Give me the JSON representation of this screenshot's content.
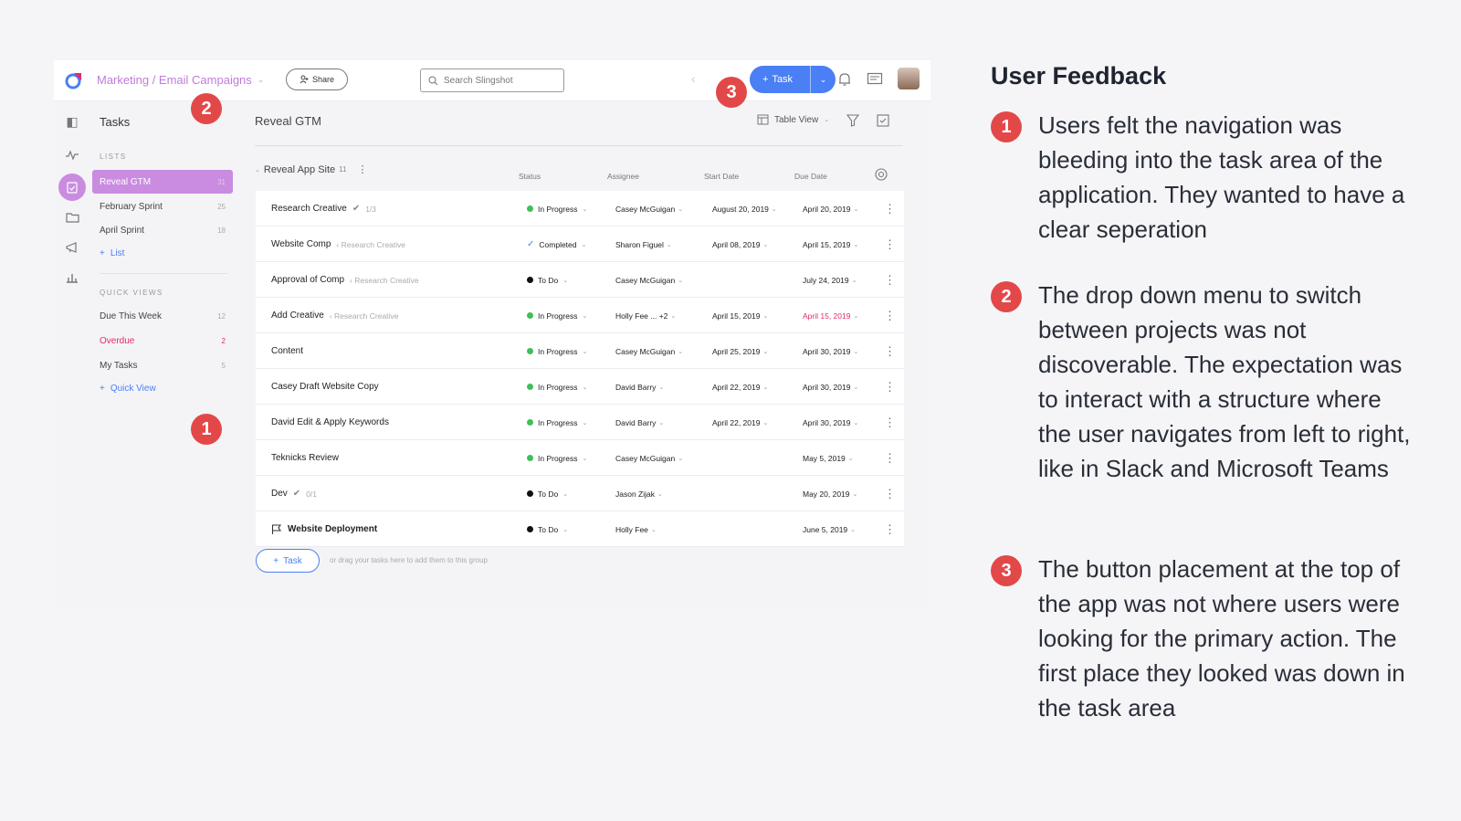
{
  "app": {
    "breadcrumb": "Marketing / Email Campaigns",
    "share_label": "Share",
    "search_placeholder": "Search Slingshot",
    "task_button_label": "Task",
    "accent_color": "#4a7ff5",
    "nav_accent_color": "#c98ce0"
  },
  "sidebar": {
    "title": "Tasks",
    "lists_header": "LISTS",
    "lists": [
      {
        "label": "Reveal GTM",
        "count": "31"
      },
      {
        "label": "February Sprint",
        "count": "25"
      },
      {
        "label": "April Sprint",
        "count": "18"
      }
    ],
    "add_list_label": "List",
    "quick_views_header": "QUICK VIEWS",
    "quick_views": [
      {
        "label": "Due This Week",
        "count": "12"
      },
      {
        "label": "Overdue",
        "count": "2"
      },
      {
        "label": "My Tasks",
        "count": "5"
      }
    ],
    "add_quick_view_label": "Quick View"
  },
  "main": {
    "title": "Reveal GTM",
    "view_label": "Table View",
    "group_name": "Reveal App Site",
    "group_count": "11",
    "columns": {
      "status": "Status",
      "assignee": "Assignee",
      "start": "Start Date",
      "due": "Due Date"
    },
    "rows": [
      {
        "name": "Research Creative",
        "sub": "1/3",
        "status": "In Progress",
        "assignee": "Casey McGuigan",
        "start": "August 20, 2019",
        "due": "April 20, 2019"
      },
      {
        "name": "Website Comp",
        "sub": "Research Creative",
        "status": "Completed",
        "assignee": "Sharon Figuel",
        "start": "April 08, 2019",
        "due": "April 15, 2019"
      },
      {
        "name": "Approval of Comp",
        "sub": "Research Creative",
        "status": "To Do",
        "assignee": "Casey McGuigan",
        "start": "",
        "due": "July 24, 2019"
      },
      {
        "name": "Add Creative",
        "sub": "Research Creative",
        "status": "In Progress",
        "assignee": "Holly Fee ... +2",
        "start": "April 15, 2019",
        "due": "April 15, 2019"
      },
      {
        "name": "Content",
        "sub": "",
        "status": "In Progress",
        "assignee": "Casey McGuigan",
        "start": "April 25, 2019",
        "due": "April 30, 2019"
      },
      {
        "name": "Casey Draft Website Copy",
        "sub": "",
        "status": "In Progress",
        "assignee": "David Barry",
        "start": "April 22, 2019",
        "due": "April 30, 2019"
      },
      {
        "name": "David Edit & Apply Keywords",
        "sub": "",
        "status": "In Progress",
        "assignee": "David Barry",
        "start": "April 22, 2019",
        "due": "April 30, 2019"
      },
      {
        "name": "Teknicks Review",
        "sub": "",
        "status": "In Progress",
        "assignee": "Casey McGuigan",
        "start": "",
        "due": "May 5, 2019"
      },
      {
        "name": "Dev",
        "sub": "0/1",
        "status": "To Do",
        "assignee": "Jason Zijak",
        "start": "",
        "due": "May 20, 2019"
      },
      {
        "name": "Website Deployment",
        "sub": "",
        "status": "To Do",
        "assignee": "Holly Fee",
        "start": "",
        "due": "June 5, 2019"
      }
    ],
    "add_task_label": "Task",
    "add_task_hint": "or drag your tasks here to add them to this group"
  },
  "markers": {
    "one": "1",
    "two": "2",
    "three": "3"
  },
  "feedback": {
    "title": "User Feedback",
    "items": [
      {
        "num": "1",
        "text": "Users felt the navigation was bleeding into the task area of the application. They wanted to have a clear seperation"
      },
      {
        "num": "2",
        "text": "The drop down menu to switch between projects was not discoverable. The expectation was to interact with a structure where the user navigates from left to right, like in Slack and Microsoft Teams"
      },
      {
        "num": "3",
        "text": "The button placement at the top of the app was not where users were looking for the primary action. The first place they looked was down in the task area"
      }
    ]
  }
}
